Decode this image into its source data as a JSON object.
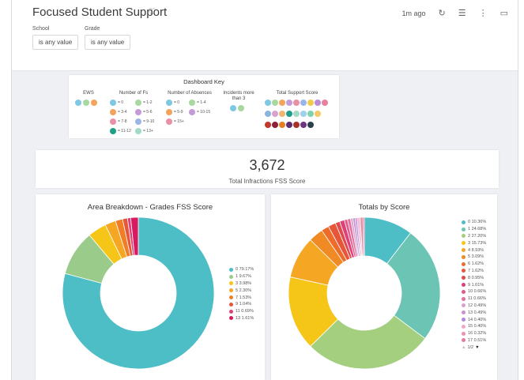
{
  "dashboard": {
    "title": "Focused Student Support",
    "updated": "1m ago"
  },
  "filters": [
    {
      "label": "School",
      "value": "is any value"
    },
    {
      "label": "Grade",
      "value": "is any value"
    }
  ],
  "key": {
    "title": "Dashboard Key",
    "headers": {
      "ews": "EWS",
      "fs": "Number of Fs",
      "absences": "Number of Absences",
      "incidents": "Incidents more than 3",
      "support": "Total Support Score"
    },
    "fs_items": [
      {
        "color": "#7ec8e3",
        "text": "= 0"
      },
      {
        "color": "#a8d8a0",
        "text": "= 1-2"
      },
      {
        "color": "#f3a45c",
        "text": "= 3-4"
      },
      {
        "color": "#c49bd8",
        "text": "= 5-6"
      },
      {
        "color": "#e98fa6",
        "text": "= 7-8"
      },
      {
        "color": "#9bb5e8",
        "text": "= 9-10"
      },
      {
        "color": "#1f9e89",
        "text": "= 11-12"
      },
      {
        "color": "#a3d9c9",
        "text": "= 13+"
      }
    ],
    "abs_items": [
      {
        "color": "#7ec8e3",
        "text": "= 0"
      },
      {
        "color": "#a8d8a0",
        "text": "= 1-4"
      },
      {
        "color": "#f3a45c",
        "text": "= 5-9"
      },
      {
        "color": "#c49bd8",
        "text": "= 10-15"
      },
      {
        "color": "#e98fa6",
        "text": "= 15+"
      }
    ]
  },
  "kpi": {
    "value": "3,672",
    "label": "Total Infractions FSS Score"
  },
  "charts": {
    "left_title": "Area Breakdown - Grades FSS Score",
    "right_title": "Totals by Score",
    "pager": "1/2"
  },
  "chart_data": [
    {
      "type": "pie",
      "title": "Area Breakdown - Grades FSS Score",
      "labels": [
        "0",
        "1",
        "3",
        "5",
        "7",
        "9",
        "11",
        "13"
      ],
      "values": [
        79.17,
        9.67,
        3.98,
        2.3,
        1.53,
        1.04,
        0.69,
        1.61
      ],
      "legend": [
        "0 79.17%",
        "1 9.67%",
        "3 3.98%",
        "5 2.30%",
        "7 1.53%",
        "9 1.04%",
        "11 0.69%",
        "13 1.61%"
      ],
      "colors": [
        "#4dbdc6",
        "#9acb8a",
        "#f5c518",
        "#f5a623",
        "#f07e26",
        "#e8563a",
        "#e0407a",
        "#d81b60"
      ],
      "legend_placement": "right"
    },
    {
      "type": "pie",
      "title": "Totals by Score",
      "labels": [
        "0",
        "1",
        "2",
        "3",
        "4",
        "5",
        "6",
        "7",
        "8",
        "9",
        "10",
        "11",
        "12",
        "13",
        "14",
        "15",
        "16",
        "17",
        "18"
      ],
      "values": [
        10.36,
        24.68,
        27.2,
        15.73,
        8.93,
        3.09,
        1.62,
        1.62,
        0.95,
        1.01,
        0.66,
        0.66,
        0.49,
        0.49,
        0.4,
        0.4,
        0.32,
        0.51,
        0.31
      ],
      "legend": [
        "0 10.36%",
        "1 24.68%",
        "2 27.20%",
        "3 15.73%",
        "4 8.93%",
        "5 3.09%",
        "6 1.62%",
        "7 1.62%",
        "8 0.95%",
        "9 1.01%",
        "10 0.66%",
        "11 0.66%",
        "12 0.49%",
        "13 0.49%",
        "14 0.40%",
        "15 0.40%",
        "16 0.32%",
        "17 0.51%",
        "18 0.31%"
      ],
      "colors": [
        "#4dbdc6",
        "#6cc4b4",
        "#a3cf7f",
        "#f5c518",
        "#f5a623",
        "#f08a24",
        "#ee6c2a",
        "#e8563a",
        "#e04a4a",
        "#e0407a",
        "#e25a8c",
        "#e46e9e",
        "#d9a0c8",
        "#c98fd1",
        "#b388d9",
        "#f0a8c8",
        "#ee8fb6",
        "#e87a9e",
        "#e0607e"
      ],
      "legend_placement": "right"
    }
  ]
}
